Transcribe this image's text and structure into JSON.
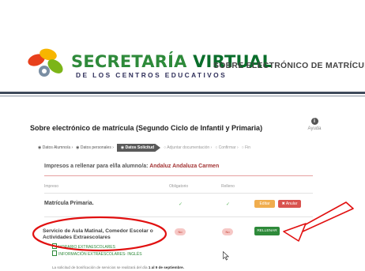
{
  "header": {
    "logo_title_1": "SECRETARÍA",
    "logo_title_2": "VIRTUAL",
    "logo_subtitle": "DE LOS CENTROS EDUCATIVOS",
    "right_title": "SOBRE ELECTRÓNICO DE MATRÍCULA"
  },
  "page": {
    "title": "Sobre electrónico de matrícula (Segundo Ciclo de Infantil y Primaria)",
    "help_label": "Ayuda"
  },
  "steps": [
    {
      "label": "Datos Alumno/a",
      "state": "done"
    },
    {
      "label": "Datos personales",
      "state": "done"
    },
    {
      "label": "Datos Solicitud",
      "state": "active"
    },
    {
      "label": "Adjuntar documentación",
      "state": "pending"
    },
    {
      "label": "Confirmar",
      "state": "pending"
    },
    {
      "label": "Fin",
      "state": "pending"
    }
  ],
  "student": {
    "prefix": "Impresos a rellenar para el/la alumno/a:",
    "name": "Andaluz Andaluza Carmen"
  },
  "table": {
    "headers": [
      "Impreso",
      "Obligatorio",
      "Relleno"
    ],
    "row1": {
      "label": "Matrícula Primaria.",
      "obligatorio": "✓",
      "relleno": "✓",
      "edit_label": "Editar",
      "cancel_label": "✖ Anular"
    },
    "row2": {
      "label": "Servicio de Aula Matinal, Comedor Escolar o Actividades Extraescolares",
      "obligatorio": "No",
      "relleno": "No",
      "fill_label": "RELLENAR",
      "doc1": "HORARIO EXTRAESCOLARES",
      "doc2": "INFORMACIÓN EXTRAESCOLARES- INGLÉS"
    }
  },
  "footnote": {
    "text": "La solicitud de bonificación de servicios se realizará del día",
    "dates": "1 al 9 de septiembre."
  },
  "colors": {
    "brand_green": "#2e8a3a",
    "annotation_red": "#e11010",
    "edit_orange": "#f0ad4e",
    "cancel_red": "#d9534f"
  }
}
